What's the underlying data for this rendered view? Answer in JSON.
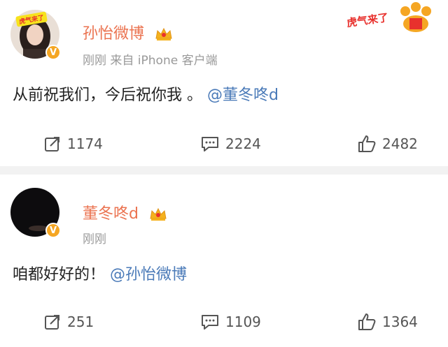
{
  "post1": {
    "username": "孙怡微博",
    "meta": "刚刚  来自 iPhone 客户端",
    "content_text": "从前祝我们，今后祝你我 。",
    "content_mention": "@董冬咚d",
    "sticker_text": "虎气来了",
    "avatar_label": "虎气来了",
    "verified": "V",
    "reposts": "1174",
    "comments": "2224",
    "likes": "2482"
  },
  "post2": {
    "username": "董冬咚d",
    "meta": "刚刚",
    "content_text": "咱都好好的！",
    "content_mention": "@孙怡微博",
    "verified": "V",
    "reposts": "251",
    "comments": "1109",
    "likes": "1364"
  },
  "colors": {
    "username": "#eb7350",
    "mention": "#4a7ab8",
    "meta": "#999999",
    "badge": "#f5a623",
    "sticker": "#e8312d"
  }
}
